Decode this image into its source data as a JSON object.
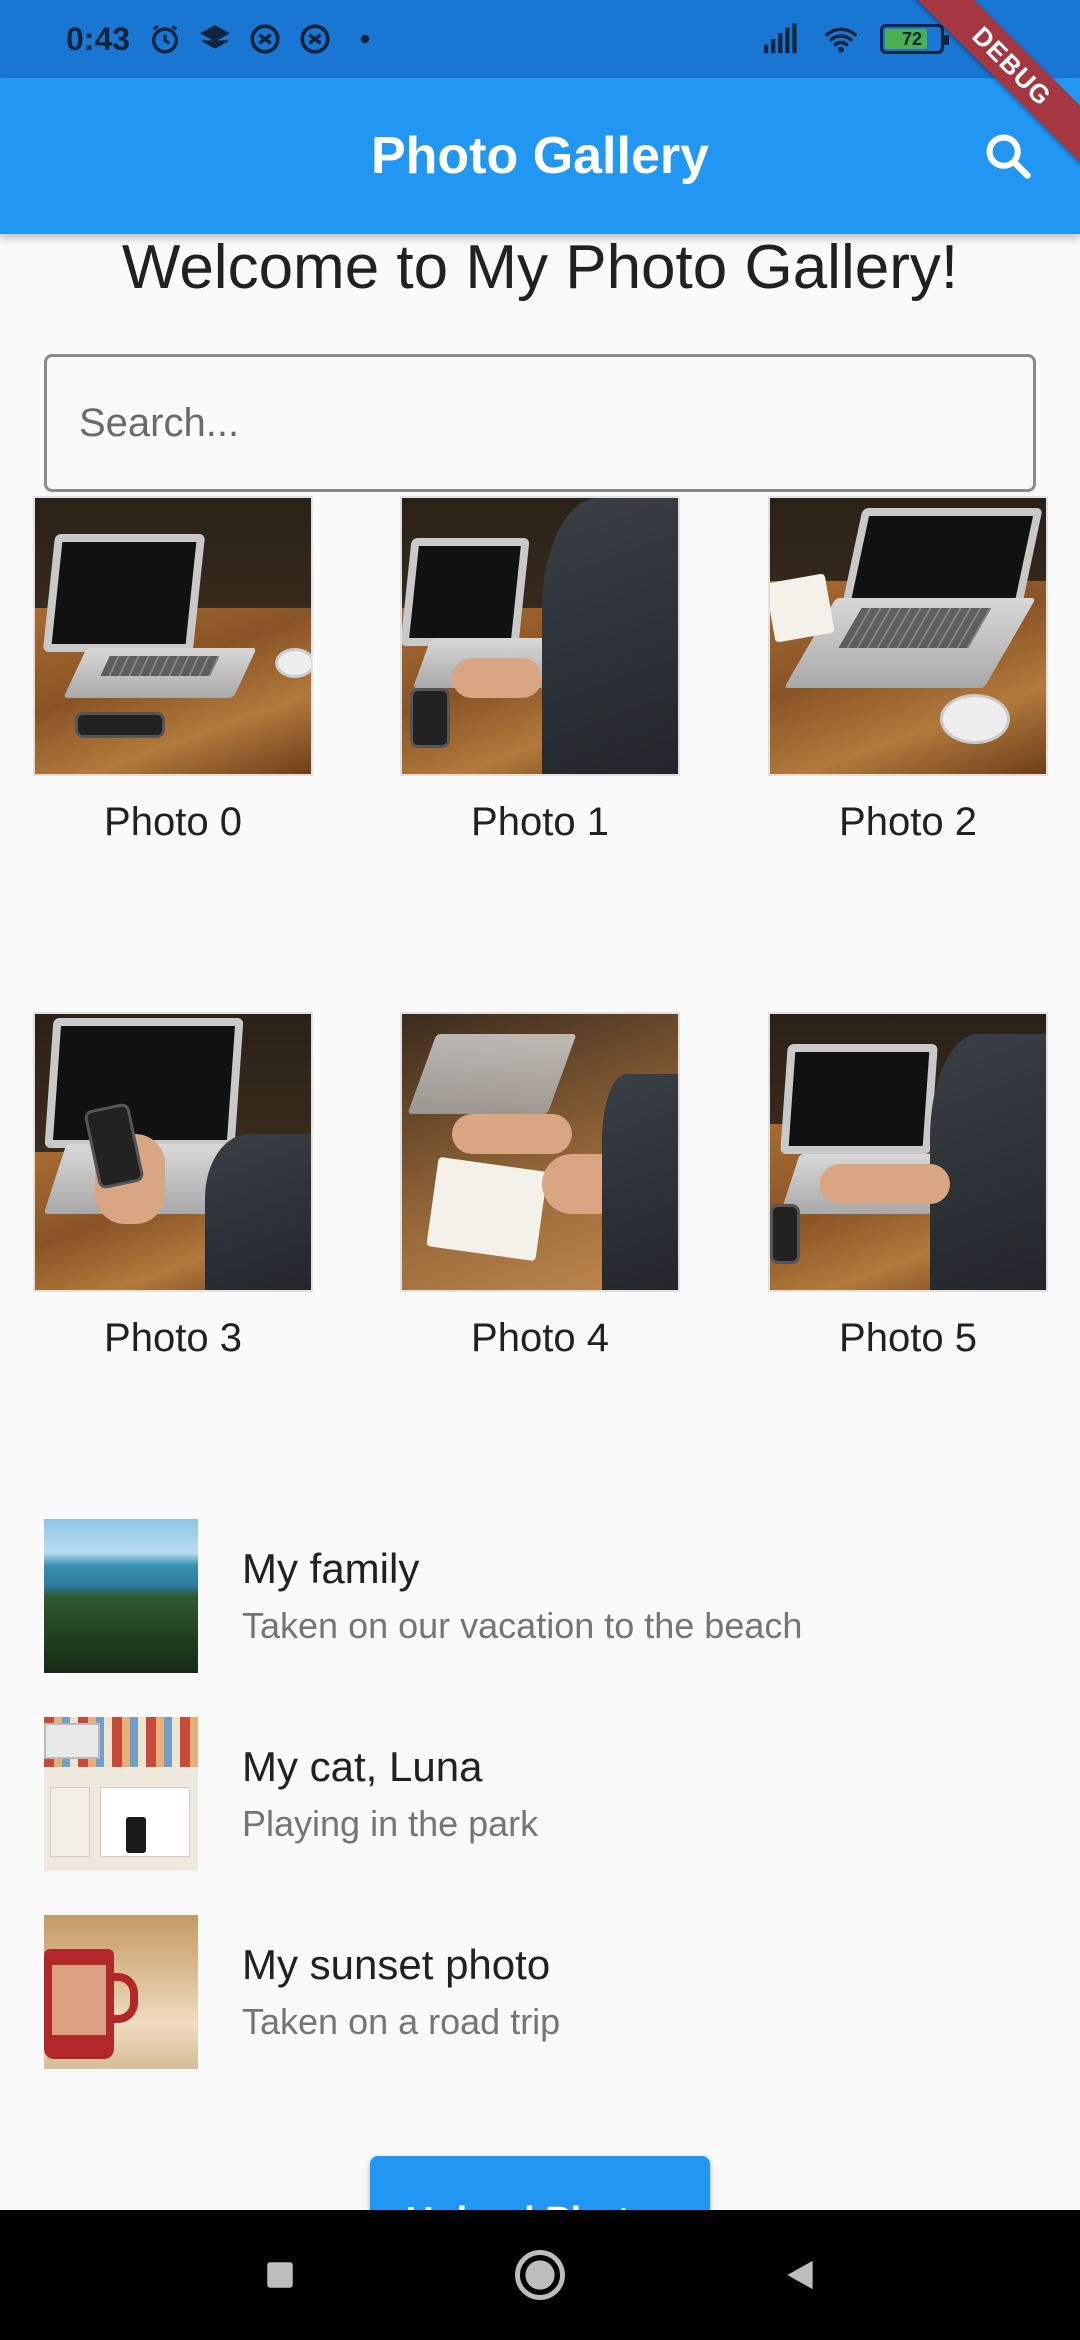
{
  "status_bar": {
    "time": "0:43",
    "battery": "72"
  },
  "app_bar": {
    "title": "Photo Gallery",
    "search_icon": "search-icon",
    "debug_banner": "DEBUG"
  },
  "welcome_text": "Welcome to My Photo Gallery!",
  "search": {
    "placeholder": "Search...",
    "value": ""
  },
  "grid": {
    "items": [
      {
        "label": "Photo 0"
      },
      {
        "label": "Photo 1"
      },
      {
        "label": "Photo 2"
      },
      {
        "label": "Photo 3"
      },
      {
        "label": "Photo 4"
      },
      {
        "label": "Photo 5"
      }
    ]
  },
  "list": {
    "items": [
      {
        "title": "My family",
        "subtitle": "Taken on our vacation to the beach"
      },
      {
        "title": "My cat, Luna",
        "subtitle": "Playing in the park"
      },
      {
        "title": "My sunset photo",
        "subtitle": "Taken on a road trip"
      }
    ]
  },
  "upload_button": {
    "label": "Upload Photos"
  },
  "nav": {
    "recents_icon": "square-icon",
    "home_icon": "circle-icon",
    "back_icon": "triangle-back-icon"
  },
  "colors": {
    "primary": "#2196f3",
    "status_bar": "#1976d2",
    "background": "#fafafa",
    "debug_banner": "#a4373f"
  }
}
